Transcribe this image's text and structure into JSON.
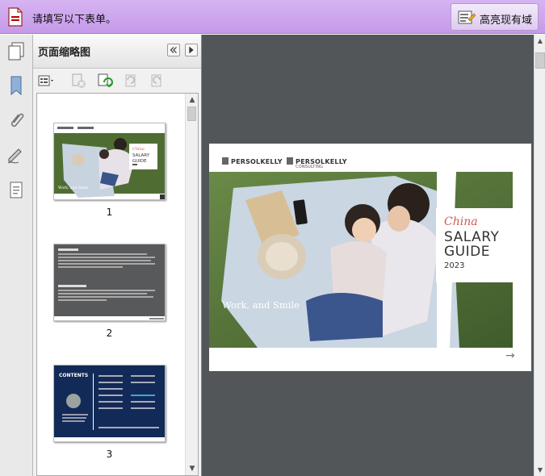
{
  "form_bar": {
    "message": "请填写以下表单。",
    "highlight_button": "高亮现有域"
  },
  "panel": {
    "title": "页面缩略图"
  },
  "thumbnails": [
    {
      "page": "1",
      "label": "Work, and Smile"
    },
    {
      "page": "2"
    },
    {
      "page": "3",
      "label": "CONTENTS"
    }
  ],
  "document": {
    "logo_1": "PERSOLKELLY",
    "logo_2": "PERSOLKELLY",
    "logo_2_sub": "CONSULTING",
    "title_italic": "China",
    "title_line1": "SALARY",
    "title_line2": "GUIDE",
    "year": "2023",
    "tagline": "Work, and Smile"
  },
  "colors": {
    "form_bar": "#c9a2ec",
    "viewer_bg": "#525659",
    "accent_red": "#d2594f",
    "contents_navy": "#122a57"
  }
}
